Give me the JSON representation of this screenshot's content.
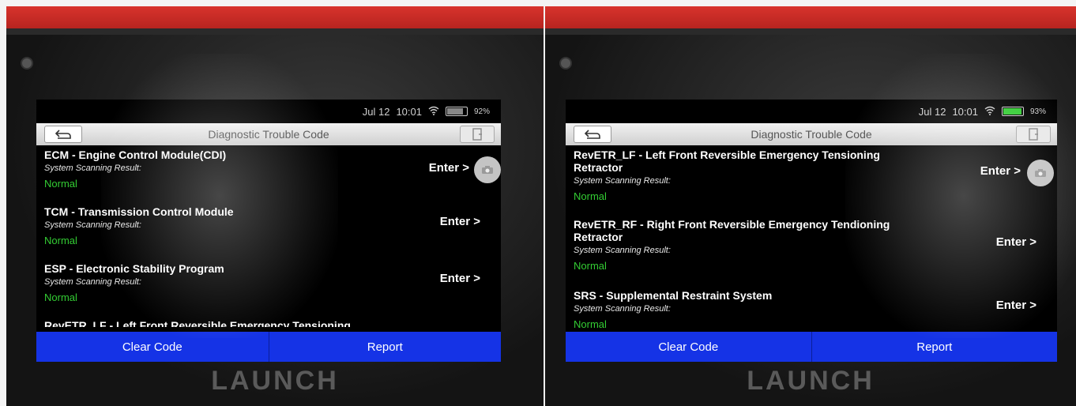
{
  "brand": "LAUNCH",
  "panels": [
    {
      "status": {
        "date": "Jul 12",
        "time": "10:01",
        "battery": "92%"
      },
      "title": "Diagnostic Trouble Code",
      "items": [
        {
          "title": "ECM - Engine Control Module(CDI)",
          "subtitle": "System Scanning Result:",
          "status": "Normal",
          "enter": "Enter >"
        },
        {
          "title": "TCM - Transmission Control Module",
          "subtitle": "System Scanning Result:",
          "status": "Normal",
          "enter": "Enter >"
        },
        {
          "title": "ESP - Electronic Stability Program",
          "subtitle": "System Scanning Result:",
          "status": "Normal",
          "enter": "Enter >"
        }
      ],
      "clipped_item": "RevETR_LF - Left Front Reversible Emergency Tensioning",
      "buttons": {
        "clear": "Clear Code",
        "report": "Report"
      }
    },
    {
      "status": {
        "date": "Jul 12",
        "time": "10:01",
        "battery": "93%"
      },
      "title": "Diagnostic Trouble Code",
      "items": [
        {
          "title": "RevETR_LF - Left Front Reversible Emergency Tensioning Retractor",
          "subtitle": "System Scanning Result:",
          "status": "Normal",
          "enter": "Enter >"
        },
        {
          "title": "RevETR_RF - Right Front Reversible Emergency Tendioning Retractor",
          "subtitle": "System Scanning Result:",
          "status": "Normal",
          "enter": "Enter >"
        },
        {
          "title": "SRS - Supplemental Restraint System",
          "subtitle": "System Scanning Result:",
          "status": "Normal",
          "enter": "Enter >"
        }
      ],
      "buttons": {
        "clear": "Clear Code",
        "report": "Report"
      }
    }
  ]
}
